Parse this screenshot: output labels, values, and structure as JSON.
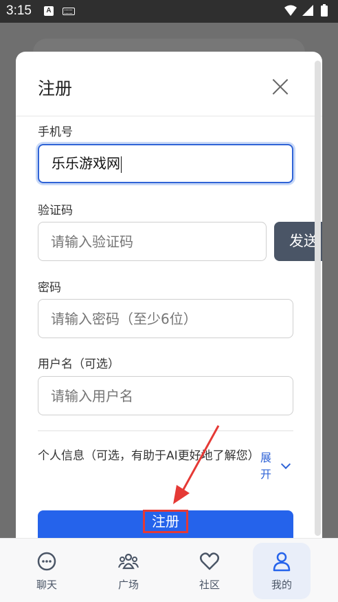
{
  "status_bar": {
    "time": "3:15",
    "notification_icon": "A",
    "icons": [
      "wifi-icon",
      "signal-icon",
      "battery-icon"
    ]
  },
  "modal": {
    "title": "注册",
    "fields": {
      "phone": {
        "label": "手机号",
        "value": "乐乐游戏网"
      },
      "code": {
        "label": "验证码",
        "placeholder": "请输入验证码"
      },
      "password": {
        "label": "密码",
        "placeholder": "请输入密码（至少6位）"
      },
      "username": {
        "label": "用户名（可选）",
        "placeholder": "请输入用户名"
      }
    },
    "send_code_label": "发送",
    "personal_info_label": "个人信息（可选，有助于AI更好地了解您）",
    "expand_label": "展开",
    "submit_label": "注册"
  },
  "bottom_nav": {
    "items": [
      {
        "label": "聊天",
        "icon": "chat-icon"
      },
      {
        "label": "广场",
        "icon": "people-icon"
      },
      {
        "label": "社区",
        "icon": "heart-icon"
      },
      {
        "label": "我的",
        "icon": "user-icon",
        "active": true
      }
    ]
  },
  "colors": {
    "primary": "#2563eb",
    "send_button": "#4a5566",
    "annotation_red": "#e53935"
  }
}
